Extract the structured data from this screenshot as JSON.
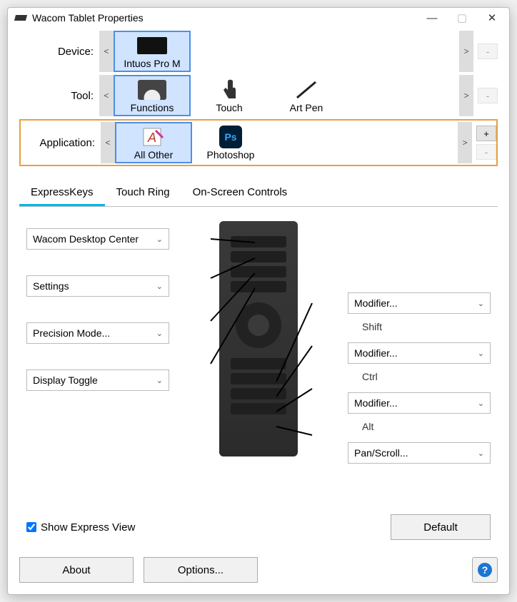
{
  "window": {
    "title": "Wacom Tablet Properties"
  },
  "rows": {
    "device": {
      "label": "Device:",
      "items": [
        {
          "label": "Intuos Pro M",
          "selected": true
        }
      ]
    },
    "tool": {
      "label": "Tool:",
      "items": [
        {
          "label": "Functions",
          "selected": true
        },
        {
          "label": "Touch"
        },
        {
          "label": "Art Pen"
        }
      ]
    },
    "application": {
      "label": "Application:",
      "items": [
        {
          "label": "All Other",
          "selected": true
        },
        {
          "label": "Photoshop"
        }
      ]
    }
  },
  "nav": {
    "prev": "<",
    "next": ">",
    "add": "+",
    "remove": "-"
  },
  "tabs": [
    {
      "label": "ExpressKeys",
      "active": true
    },
    {
      "label": "Touch Ring"
    },
    {
      "label": "On-Screen Controls"
    }
  ],
  "expresskeys": {
    "left": [
      {
        "label": "Wacom Desktop Center"
      },
      {
        "label": "Settings"
      },
      {
        "label": "Precision Mode..."
      },
      {
        "label": "Display Toggle"
      }
    ],
    "right": [
      {
        "label": "Modifier...",
        "sub": "Shift"
      },
      {
        "label": "Modifier...",
        "sub": "Ctrl"
      },
      {
        "label": "Modifier...",
        "sub": "Alt"
      },
      {
        "label": "Pan/Scroll..."
      }
    ]
  },
  "footer": {
    "showExpressView": "Show Express View",
    "default": "Default",
    "about": "About",
    "options": "Options..."
  }
}
